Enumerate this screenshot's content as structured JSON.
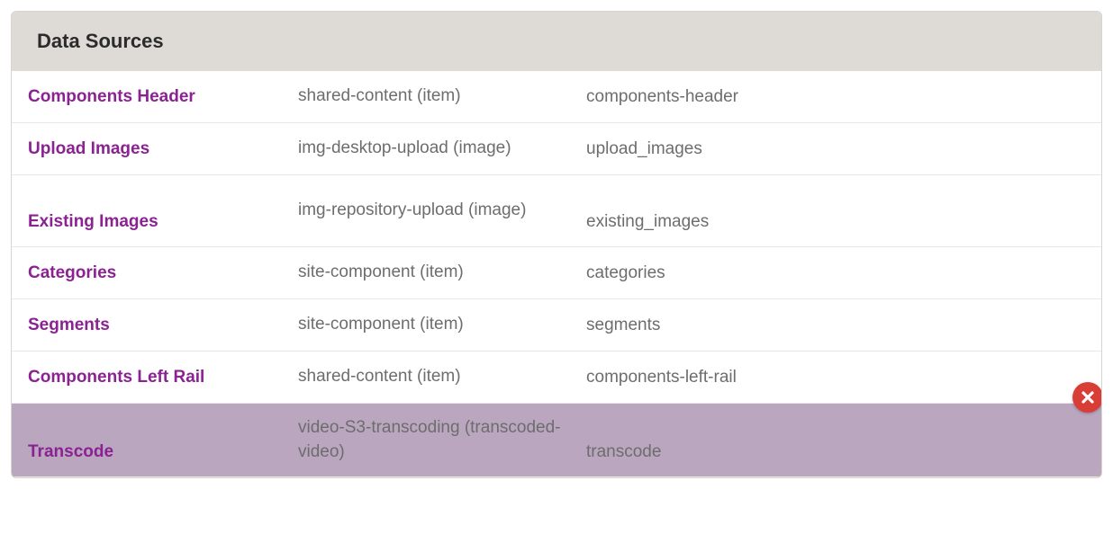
{
  "header": {
    "title": "Data Sources"
  },
  "rows": [
    {
      "name": "Components Header",
      "type": "shared-content (item)",
      "id": "components-header",
      "selected": false,
      "multiline": false
    },
    {
      "name": "Upload Images",
      "type": "img-desktop-upload (image)",
      "id": "upload_images",
      "selected": false,
      "multiline": false
    },
    {
      "name": "Existing Images",
      "type": "img-repository-upload (image)",
      "id": "existing_images",
      "selected": false,
      "multiline": true
    },
    {
      "name": "Categories",
      "type": "site-component (item)",
      "id": "categories",
      "selected": false,
      "multiline": false
    },
    {
      "name": "Segments",
      "type": "site-component (item)",
      "id": "segments",
      "selected": false,
      "multiline": false
    },
    {
      "name": "Components Left Rail",
      "type": "shared-content (item)",
      "id": "components-left-rail",
      "selected": false,
      "multiline": false
    },
    {
      "name": "Transcode",
      "type": "video-S3-transcoding (transcoded-video)",
      "id": "transcode",
      "selected": true,
      "multiline": true
    }
  ],
  "icons": {
    "delete": "close-icon"
  }
}
